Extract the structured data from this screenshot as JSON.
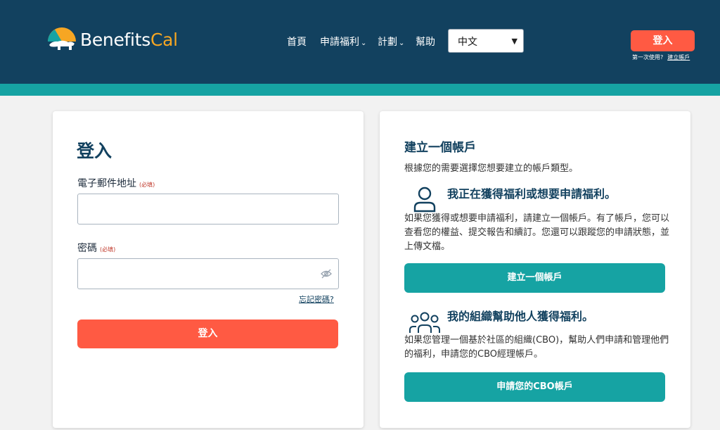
{
  "header": {
    "logo": {
      "text_main": "Benefits",
      "text_accent": "Cal"
    },
    "nav": [
      {
        "label": "首頁"
      },
      {
        "label": "申請福利"
      },
      {
        "label": "計劃"
      },
      {
        "label": "幫助"
      }
    ],
    "language": {
      "selected": "中文"
    },
    "login_button": "登入",
    "first_time_text": "第一次使用?",
    "create_account_link": "建立帳戶"
  },
  "login_card": {
    "title": "登入",
    "email_label": "電子郵件地址",
    "email_required": "(必填)",
    "email_value": "",
    "password_label": "密碼",
    "password_required": "(必填)",
    "password_value": "",
    "forgot_password": "忘記密碼?",
    "submit_label": "登入"
  },
  "create_card": {
    "title": "建立一個帳戶",
    "subtitle": "根據您的需要選擇您想要建立的帳戶類型。",
    "option1": {
      "title": "我正在獲得福利或想要申請福利。",
      "description": "如果您獲得或想要申請福利，請建立一個帳戶。有了帳戶，您可以查看您的權益、提交報告和續訂。您還可以跟蹤您的申請狀態，並上傳文檔。",
      "button": "建立一個帳戶"
    },
    "option2": {
      "title": "我的組織幫助他人獲得福利。",
      "description": "如果您管理一個基於社區的組織(CBO)，幫助人們申請和管理他們的福利，申請您的CBO經理帳戶。",
      "button": "申請您的CBO帳戶"
    }
  },
  "colors": {
    "header_bg": "#12415f",
    "teal": "#16a3a3",
    "primary_button": "#ff5a43",
    "logo_accent": "#f6a623"
  }
}
